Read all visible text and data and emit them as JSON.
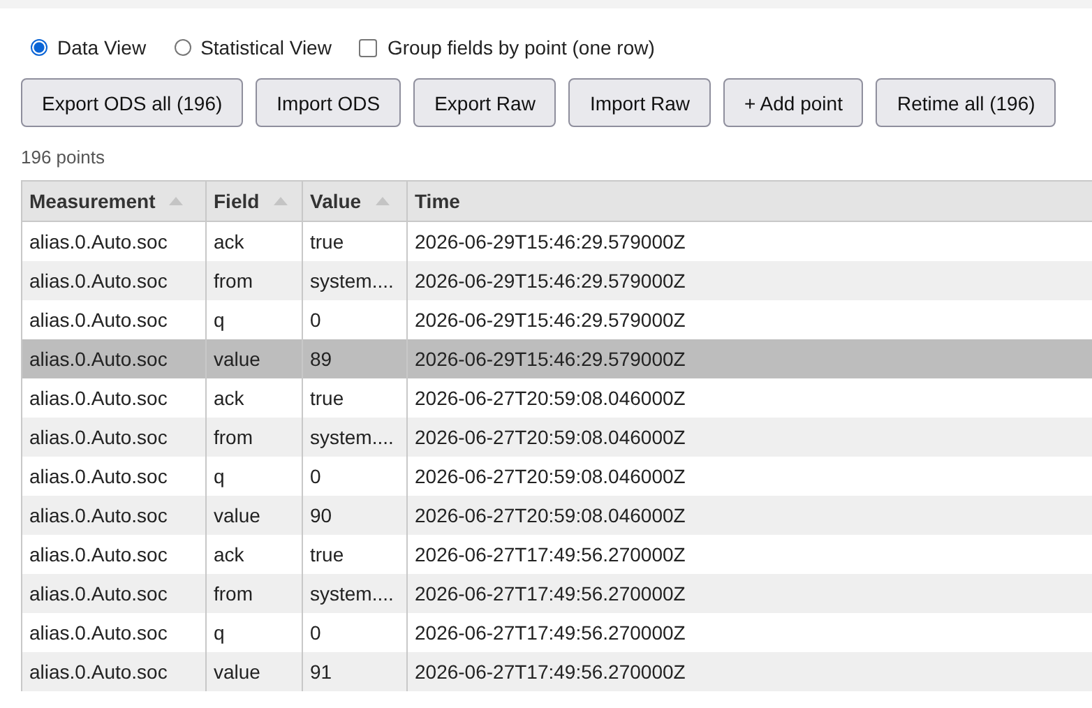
{
  "view_options": [
    {
      "label": "Data View",
      "selected": true
    },
    {
      "label": "Statistical View",
      "selected": false
    }
  ],
  "group_fields": {
    "label": "Group fields by point (one row)",
    "checked": false
  },
  "buttons": [
    "Export ODS all (196)",
    "Import ODS",
    "Export Raw",
    "Import Raw",
    "+ Add point",
    "Retime all (196)"
  ],
  "point_count": "196 points",
  "table": {
    "columns": [
      {
        "label": "Measurement",
        "sortable": true
      },
      {
        "label": "Field",
        "sortable": true
      },
      {
        "label": "Value",
        "sortable": true
      },
      {
        "label": "Time",
        "sortable": false
      }
    ],
    "rows": [
      {
        "cells": [
          "alias.0.Auto.soc",
          "ack",
          "true",
          "2026-06-29T15:46:29.579000Z"
        ],
        "selected": false
      },
      {
        "cells": [
          "alias.0.Auto.soc",
          "from",
          "system....",
          "2026-06-29T15:46:29.579000Z"
        ],
        "selected": false
      },
      {
        "cells": [
          "alias.0.Auto.soc",
          "q",
          "0",
          "2026-06-29T15:46:29.579000Z"
        ],
        "selected": false
      },
      {
        "cells": [
          "alias.0.Auto.soc",
          "value",
          "89",
          "2026-06-29T15:46:29.579000Z"
        ],
        "selected": true
      },
      {
        "cells": [
          "alias.0.Auto.soc",
          "ack",
          "true",
          "2026-06-27T20:59:08.046000Z"
        ],
        "selected": false
      },
      {
        "cells": [
          "alias.0.Auto.soc",
          "from",
          "system....",
          "2026-06-27T20:59:08.046000Z"
        ],
        "selected": false
      },
      {
        "cells": [
          "alias.0.Auto.soc",
          "q",
          "0",
          "2026-06-27T20:59:08.046000Z"
        ],
        "selected": false
      },
      {
        "cells": [
          "alias.0.Auto.soc",
          "value",
          "90",
          "2026-06-27T20:59:08.046000Z"
        ],
        "selected": false
      },
      {
        "cells": [
          "alias.0.Auto.soc",
          "ack",
          "true",
          "2026-06-27T17:49:56.270000Z"
        ],
        "selected": false
      },
      {
        "cells": [
          "alias.0.Auto.soc",
          "from",
          "system....",
          "2026-06-27T17:49:56.270000Z"
        ],
        "selected": false
      },
      {
        "cells": [
          "alias.0.Auto.soc",
          "q",
          "0",
          "2026-06-27T17:49:56.270000Z"
        ],
        "selected": false
      },
      {
        "cells": [
          "alias.0.Auto.soc",
          "value",
          "91",
          "2026-06-27T17:49:56.270000Z"
        ],
        "selected": false
      }
    ]
  }
}
